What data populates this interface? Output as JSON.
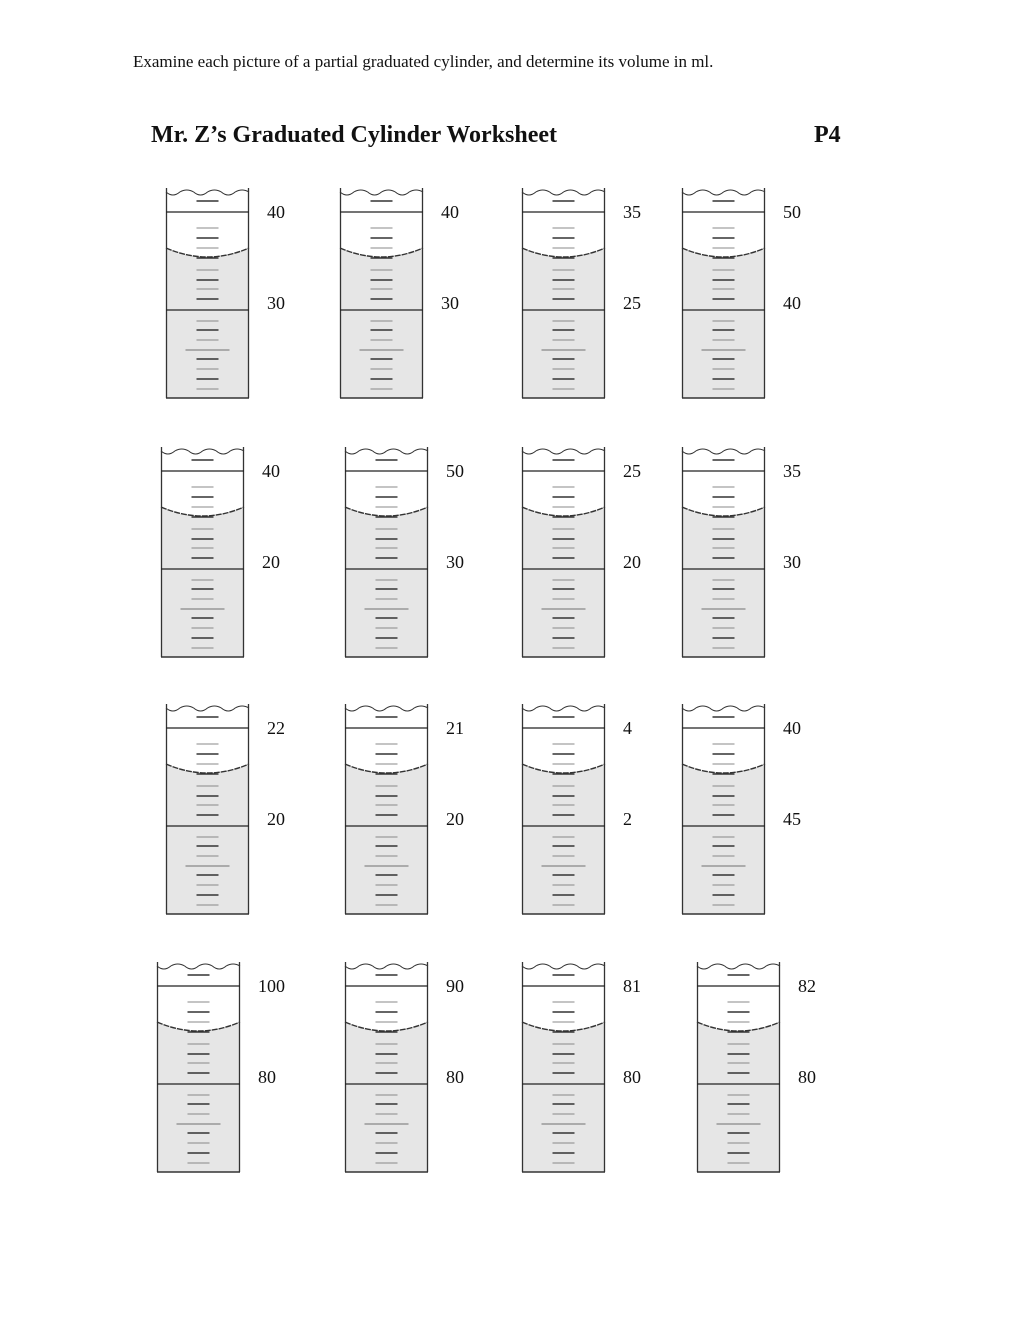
{
  "page": {
    "instructions": "Examine each picture of a partial graduated cylinder, and determine its volume in ml.",
    "title": "Mr. Z’s Graduated Cylinder  Worksheet",
    "page_id": "P4"
  },
  "colors": {
    "liquid": "#e6e6e6",
    "outline": "#333333",
    "major_line": "#222222",
    "tick_dark": "#333333",
    "tick_light": "#888888"
  },
  "cylinders": [
    {
      "row": 1,
      "col": 1,
      "top_label": "40",
      "mid_label": "30"
    },
    {
      "row": 1,
      "col": 2,
      "top_label": "40",
      "mid_label": "30"
    },
    {
      "row": 1,
      "col": 3,
      "top_label": "35",
      "mid_label": "25"
    },
    {
      "row": 1,
      "col": 4,
      "top_label": "50",
      "mid_label": "40"
    },
    {
      "row": 2,
      "col": 1,
      "top_label": "40",
      "mid_label": "20"
    },
    {
      "row": 2,
      "col": 2,
      "top_label": "50",
      "mid_label": "30"
    },
    {
      "row": 2,
      "col": 3,
      "top_label": "25",
      "mid_label": "20"
    },
    {
      "row": 2,
      "col": 4,
      "top_label": "35",
      "mid_label": "30"
    },
    {
      "row": 3,
      "col": 1,
      "top_label": "22",
      "mid_label": "20"
    },
    {
      "row": 3,
      "col": 2,
      "top_label": "21",
      "mid_label": "20"
    },
    {
      "row": 3,
      "col": 3,
      "top_label": "4",
      "mid_label": "2"
    },
    {
      "row": 3,
      "col": 4,
      "top_label": "40",
      "mid_label": "45"
    },
    {
      "row": 4,
      "col": 1,
      "top_label": "100",
      "mid_label": "80"
    },
    {
      "row": 4,
      "col": 2,
      "top_label": "90",
      "mid_label": "80"
    },
    {
      "row": 4,
      "col": 3,
      "top_label": "81",
      "mid_label": "80"
    },
    {
      "row": 4,
      "col": 4,
      "top_label": "82",
      "mid_label": "80"
    }
  ]
}
